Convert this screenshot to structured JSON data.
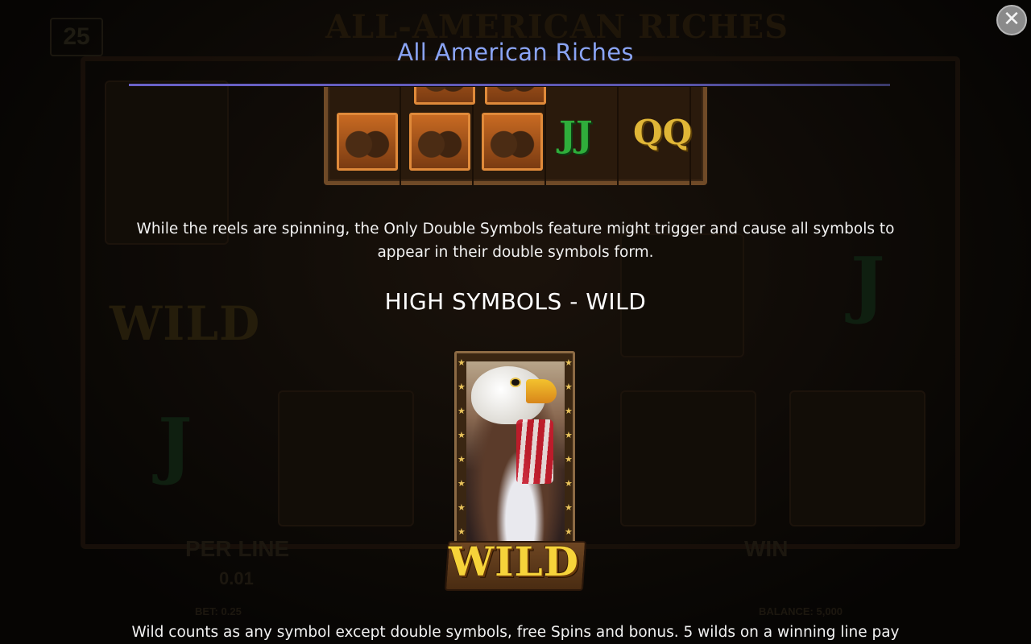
{
  "modal": {
    "title": "All American Riches",
    "close_glyph": "✕",
    "accent_color": "#8aa4f5",
    "feature_paragraph": "While the reels are spinning, the Only Double Symbols feature might trigger and cause all symbols to appear in their double symbols form.",
    "section_heading": "HIGH SYMBOLS - WILD",
    "wild_label": "WILD",
    "wild_paragraph": "Wild counts as any symbol except double symbols, free Spins and bonus. 5 wilds on a winning line pay"
  },
  "reel_example": {
    "symbols": [
      "bison-double",
      "bison-double",
      "bison-double",
      "J-double",
      "Q-double"
    ],
    "letter_j": "JJ",
    "letter_q": "QQ"
  },
  "background_game": {
    "game_logo": "ALL-AMERICAN RICHES",
    "lines_count": "25",
    "per_line_label": "PER LINE",
    "per_line_value": "0.01",
    "bet_text": "BET: 0.25",
    "win_label": "WIN",
    "balance_text": "BALANCE: 5,000",
    "wild_text": "WILD"
  }
}
